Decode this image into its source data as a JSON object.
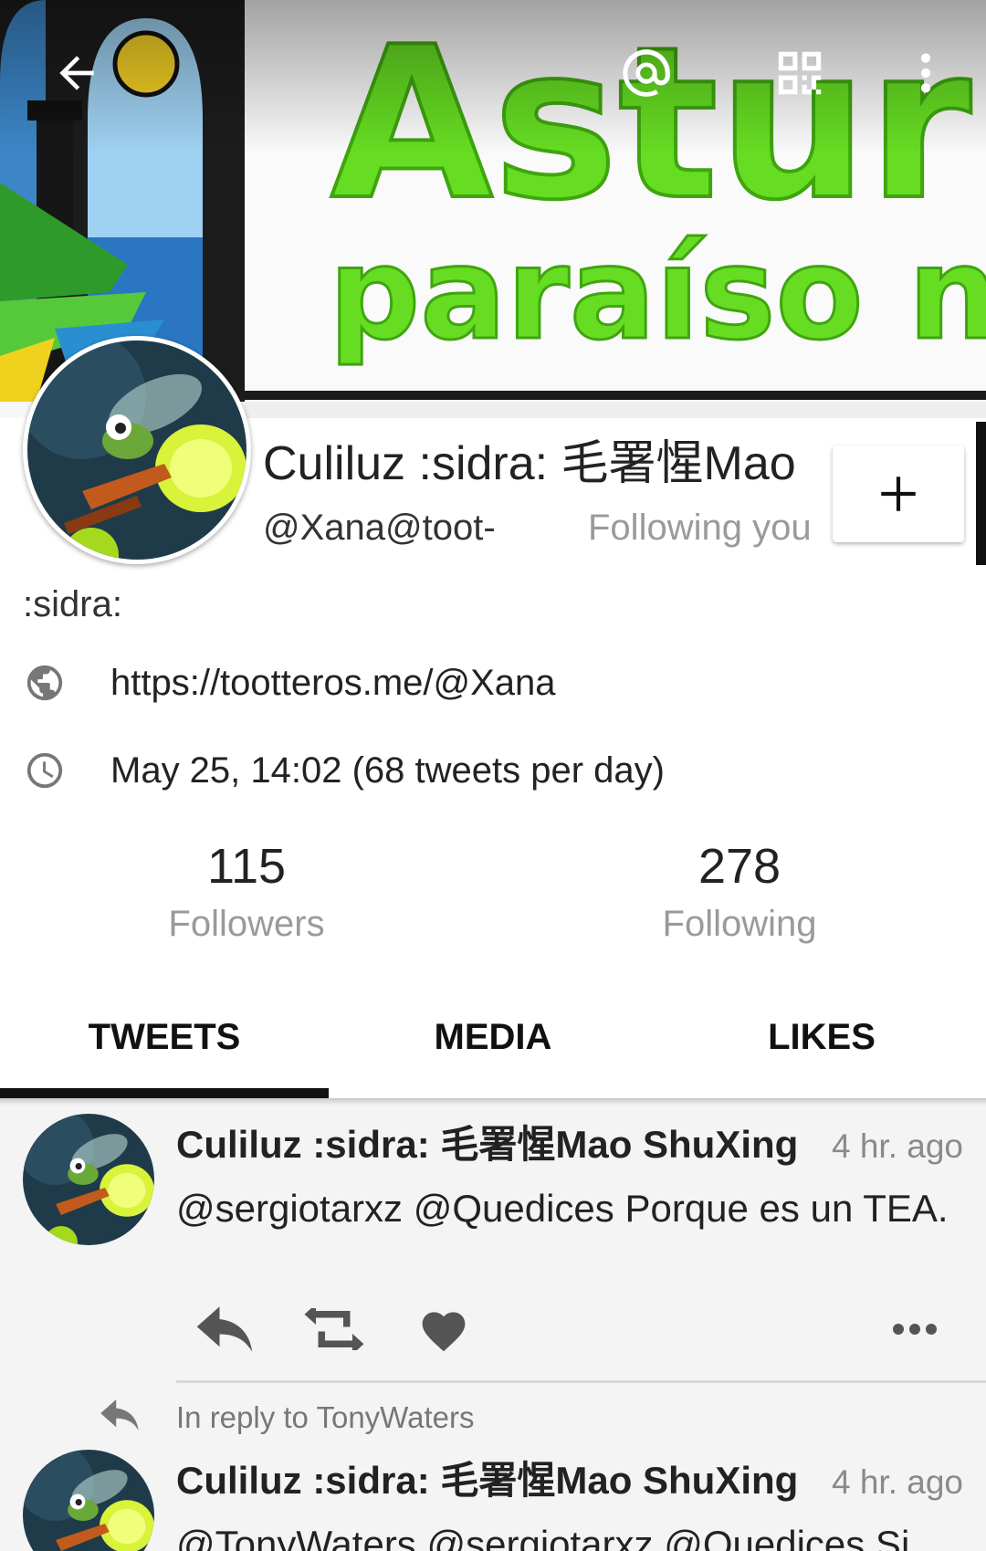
{
  "toolbar": {
    "back_icon": "arrow-left-icon",
    "mention_icon": "at-sign-icon",
    "qr_icon": "qr-code-icon",
    "menu_icon": "more-vertical-icon"
  },
  "banner": {
    "line1": "Asturi",
    "line2": "paraíso na"
  },
  "profile": {
    "display_name": "Culiluz :sidra: 毛署惺Mao",
    "handle": "@Xana@toot-",
    "follows_you": "Following you",
    "follow_button_label": "+",
    "bio": ":sidra:",
    "website": "https://tootteros.me/@Xana",
    "joined": "May 25, 14:02 (68 tweets per day)"
  },
  "stats": {
    "followers_count": "115",
    "followers_label": "Followers",
    "following_count": "278",
    "following_label": "Following"
  },
  "tabs": [
    {
      "label": "TWEETS"
    },
    {
      "label": "MEDIA"
    },
    {
      "label": "LIKES"
    }
  ],
  "posts": [
    {
      "author": "Culiluz :sidra: 毛署惺Mao ShuXing",
      "time": "4 hr. ago",
      "text": "@sergiotarxz @Quedices Porque es un TEA."
    },
    {
      "reply_note": "In reply to TonyWaters",
      "author": "Culiluz :sidra: 毛署惺Mao ShuXing",
      "time": "4 hr. ago",
      "text": "@TonyWaters @sergiotarxz @Quedices Si"
    }
  ],
  "colors": {
    "banner_green": "#66dd22",
    "tab_indicator": "#111111",
    "secondary_text": "#9a9a9a"
  }
}
